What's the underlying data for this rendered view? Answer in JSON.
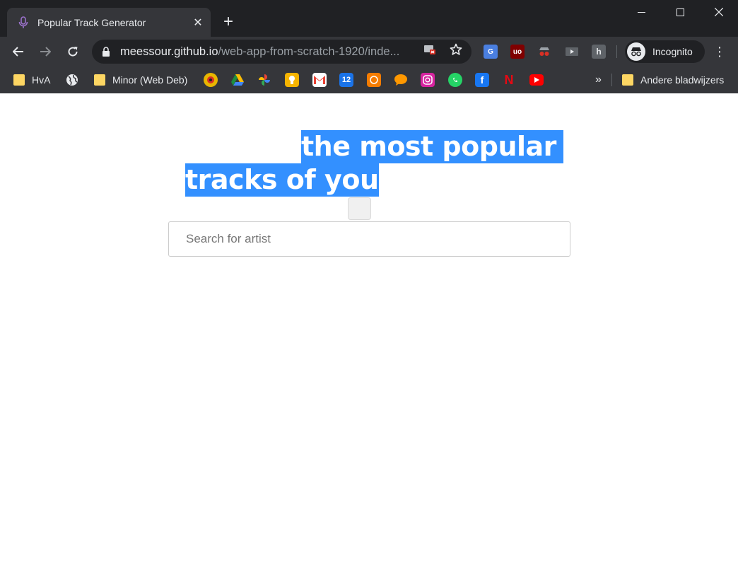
{
  "browser": {
    "tab": {
      "title": "Popular Track Generator",
      "close_glyph": "✕"
    },
    "new_tab_glyph": "+",
    "address": {
      "host": "meessour.github.io",
      "path": "/web-app-from-scratch-1920/inde..."
    },
    "incognito_label": "Incognito",
    "bookmarks": [
      {
        "label": "HvA",
        "icon": "folder-icon"
      },
      {
        "label": "",
        "icon": "globe-icon"
      },
      {
        "label": "Minor (Web Deb)",
        "icon": "folder-icon"
      }
    ],
    "more_bookmarks_glyph": "»",
    "other_bookmarks_label": "Andere bladwijzers"
  },
  "page": {
    "heading_line1": "the most popular",
    "heading_line2": "tracks of you",
    "search_placeholder": "Search for artist"
  },
  "colors": {
    "selection": "#3390ff",
    "chrome_dark": "#202124",
    "chrome_toolbar": "#35363a"
  }
}
